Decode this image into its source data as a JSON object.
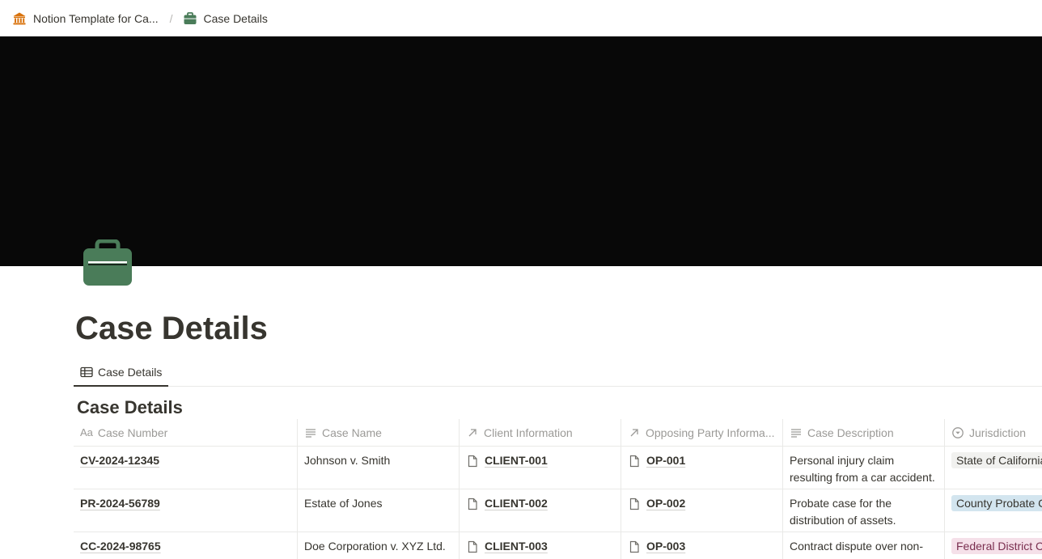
{
  "breadcrumb": {
    "items": [
      {
        "label": "Notion Template for Ca...",
        "icon": "building-columns-icon"
      },
      {
        "label": "Case Details",
        "icon": "briefcase-icon"
      }
    ],
    "separator": "/"
  },
  "page": {
    "title": "Case Details",
    "icon": "briefcase-icon",
    "cover_color": "#080808"
  },
  "views": {
    "tabs": [
      {
        "label": "Case Details",
        "icon": "table-icon"
      }
    ]
  },
  "database": {
    "title": "Case Details",
    "columns": [
      {
        "label": "Case Number",
        "icon": "title-aa-icon"
      },
      {
        "label": "Case Name",
        "icon": "text-lines-icon"
      },
      {
        "label": "Client Information",
        "icon": "relation-arrow-icon"
      },
      {
        "label": "Opposing Party Informa...",
        "icon": "relation-arrow-icon"
      },
      {
        "label": "Case Description",
        "icon": "text-lines-icon"
      },
      {
        "label": "Jurisdiction",
        "icon": "select-circle-icon"
      }
    ],
    "rows": [
      {
        "case_number": "CV-2024-12345",
        "case_name": "Johnson v. Smith",
        "client": "CLIENT-001",
        "opposing": "OP-001",
        "description": "Personal injury claim resulting from a car accident.",
        "jurisdiction": "State of California",
        "jurisdiction_color": "#f1f1ef"
      },
      {
        "case_number": "PR-2024-56789",
        "case_name": "Estate of Jones",
        "client": "CLIENT-002",
        "opposing": "OP-002",
        "description": "Probate case for the distribution of assets.",
        "jurisdiction": "County Probate Court",
        "jurisdiction_color": "#d3e5ef"
      },
      {
        "case_number": "CC-2024-98765",
        "case_name": "Doe Corporation v. XYZ Ltd.",
        "client": "CLIENT-003",
        "opposing": "OP-003",
        "description": "Contract dispute over non-",
        "jurisdiction": "Federal District Court",
        "jurisdiction_color": "#f5e0e9"
      }
    ]
  },
  "colors": {
    "text": "#37352f",
    "muted": "#9b9a97",
    "briefcase": "#4a7c59",
    "building": "#d9730d"
  }
}
